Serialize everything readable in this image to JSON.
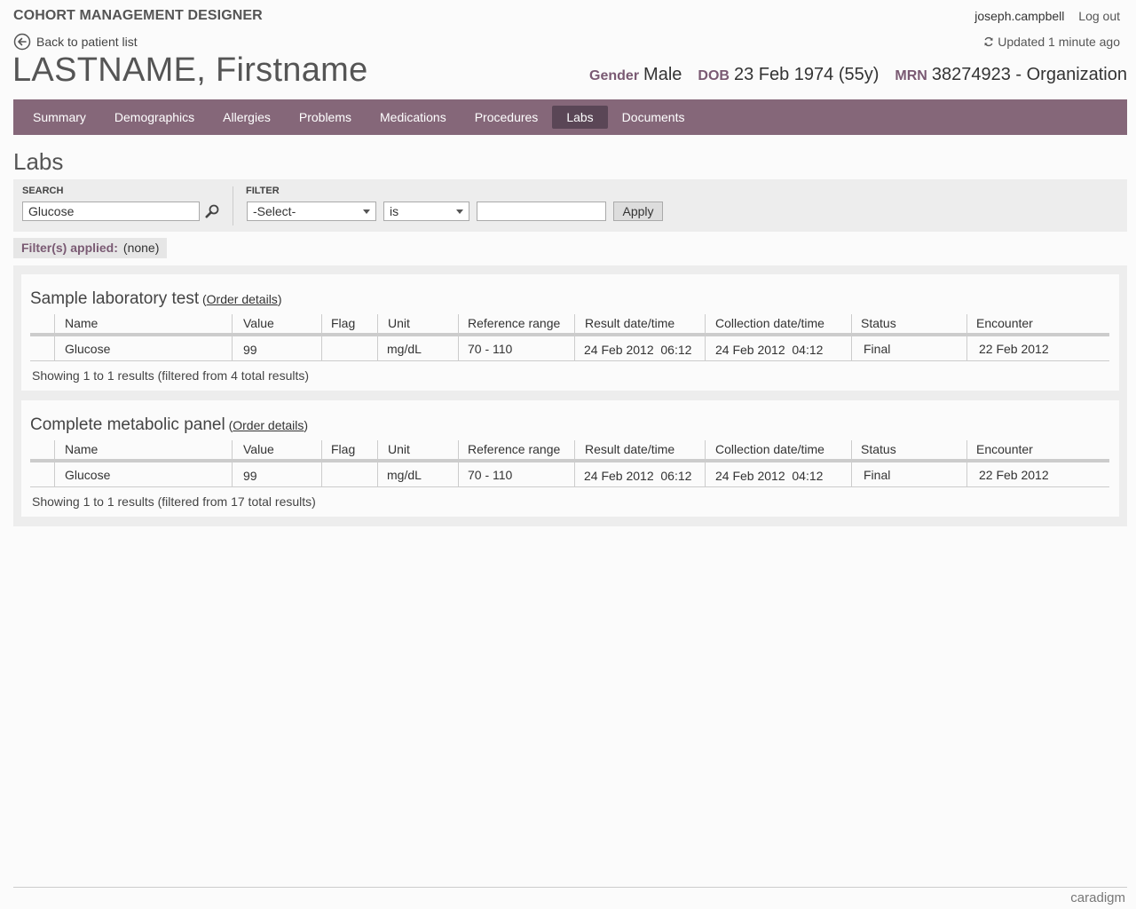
{
  "header": {
    "app_title": "COHORT MANAGEMENT DESIGNER",
    "username": "joseph.campbell",
    "logout_label": "Log out",
    "back_label": "Back to patient list",
    "updated_label": "Updated 1 minute ago"
  },
  "patient": {
    "name": "LASTNAME, Firstname",
    "gender_label": "Gender",
    "gender": "Male",
    "dob_label": "DOB",
    "dob": "23 Feb 1974 (55y)",
    "mrn_label": "MRN",
    "mrn": "38274923 - Organization"
  },
  "nav": {
    "items": [
      {
        "label": "Summary"
      },
      {
        "label": "Demographics"
      },
      {
        "label": "Allergies"
      },
      {
        "label": "Problems"
      },
      {
        "label": "Medications"
      },
      {
        "label": "Procedures"
      },
      {
        "label": "Labs",
        "active": true
      },
      {
        "label": "Documents"
      }
    ]
  },
  "page_title": "Labs",
  "search": {
    "label": "SEARCH",
    "value": "Glucose"
  },
  "filter": {
    "label": "FILTER",
    "field_selected": "-Select-",
    "operator_selected": "is",
    "value": "",
    "apply_label": "Apply"
  },
  "filters_applied": {
    "label": "Filter(s) applied:",
    "value": "(none)"
  },
  "columns": [
    "Name",
    "Value",
    "Flag",
    "Unit",
    "Reference range",
    "Result date/time",
    "Collection date/time",
    "Status",
    "Encounter"
  ],
  "panels": [
    {
      "title": "Sample laboratory test",
      "order_link": "Order details",
      "rows": [
        {
          "name": "Glucose",
          "value": "99",
          "flag": "",
          "unit": "mg/dL",
          "range": "70 - 110",
          "result": "24 Feb 2012  06:12",
          "collection": "24 Feb 2012  04:12",
          "status": "Final",
          "encounter": "22 Feb 2012"
        }
      ],
      "showing": "Showing 1 to 1 results (filtered from 4 total results)"
    },
    {
      "title": "Complete metabolic panel",
      "order_link": "Order details",
      "rows": [
        {
          "name": "Glucose",
          "value": "99",
          "flag": "",
          "unit": "mg/dL",
          "range": "70 - 110",
          "result": "24 Feb 2012  06:12",
          "collection": "24 Feb 2012  04:12",
          "status": "Final",
          "encounter": "22 Feb 2012"
        }
      ],
      "showing": "Showing 1 to 1 results (filtered from 17 total results)"
    }
  ],
  "footer": {
    "logo": "caradigm"
  },
  "colors": {
    "accent": "#856779",
    "accent_dark": "#5a4656",
    "label": "#7a5a73"
  }
}
